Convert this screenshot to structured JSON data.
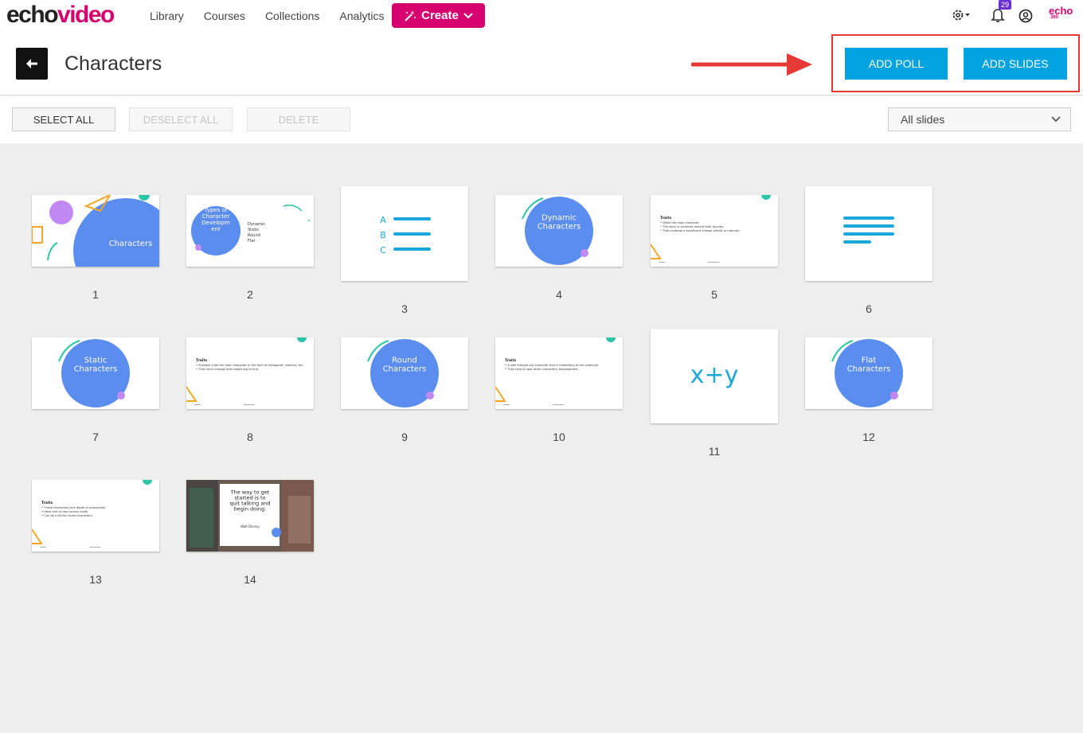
{
  "brand": {
    "echo": "echo",
    "video": "video"
  },
  "nav": {
    "links": [
      "Library",
      "Courses",
      "Collections",
      "Analytics"
    ],
    "create_label": "Create",
    "notification_count": "29",
    "echo360_top": "echo",
    "echo360_bottom": "360"
  },
  "header": {
    "title": "Characters",
    "add_poll": "ADD POLL",
    "add_slides": "ADD SLIDES"
  },
  "toolbar": {
    "select_all": "SELECT ALL",
    "deselect_all": "DESELECT ALL",
    "delete": "DELETE",
    "filter_value": "All slides"
  },
  "colors": {
    "brand": "#d6006e",
    "primary": "#00a3e0",
    "annotation": "#e53935"
  },
  "slides": [
    {
      "num": "1",
      "type": "title",
      "text": "Characters"
    },
    {
      "num": "2",
      "type": "types",
      "text": "Types of Character Developm ent",
      "list": [
        "Dynamic",
        "Static",
        "Round",
        "Flat"
      ]
    },
    {
      "num": "3",
      "type": "poll-abc",
      "letters": [
        "A",
        "B",
        "C"
      ]
    },
    {
      "num": "4",
      "type": "circle",
      "text": "Dynamic Characters"
    },
    {
      "num": "5",
      "type": "traits",
      "heading": "Traits",
      "lines": [
        "• Often the main character.",
        "• The story is centered around their journey.",
        "• They undergo a significant change (literal or internal)."
      ]
    },
    {
      "num": "6",
      "type": "poll-text"
    },
    {
      "num": "7",
      "type": "circle",
      "text": "Static Characters"
    },
    {
      "num": "8",
      "type": "traits",
      "heading": "Traits",
      "lines": [
        "• Provides a foil the main character in the form of antagonist, sidekick, etc.",
        "• They don't change from beginning to end."
      ]
    },
    {
      "num": "9",
      "type": "circle",
      "text": "Round Characters"
    },
    {
      "num": "10",
      "type": "traits",
      "heading": "Traits",
      "lines": [
        "• A well thought out character that is interesting to the audience.",
        "• They help to spur other characters' development."
      ]
    },
    {
      "num": "11",
      "type": "poll-xy",
      "text": "x+y"
    },
    {
      "num": "12",
      "type": "circle",
      "text": "Flat Characters"
    },
    {
      "num": "13",
      "type": "traits",
      "heading": "Traits",
      "lines": [
        "• These characters lack depth or personality.",
        "• Have one or two cursory traits.",
        "• Can be a foil for round characters."
      ]
    },
    {
      "num": "14",
      "type": "quote",
      "text": "The way to get started is to quit talking and begin doing.",
      "author": "Walt Disney"
    }
  ]
}
